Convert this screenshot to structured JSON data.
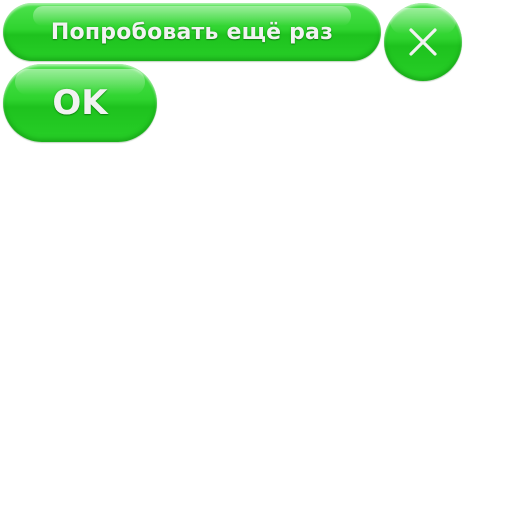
{
  "dialog": {
    "retry_label": "Попробовать ещё раз",
    "ok_label": "OK",
    "close_icon": "close-icon"
  },
  "colors": {
    "button_green": "#2fd42f",
    "label_text": "#f2f2f2",
    "background": "#ffffff"
  }
}
